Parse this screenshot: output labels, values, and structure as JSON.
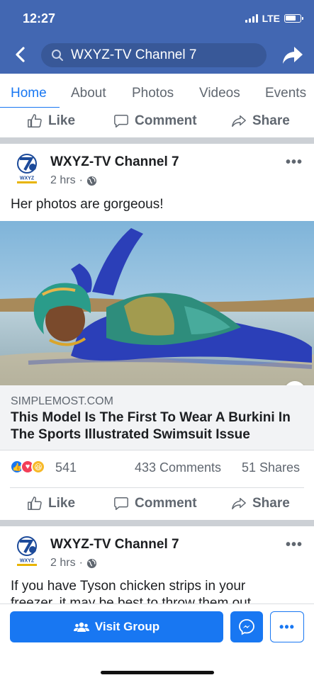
{
  "status_bar": {
    "time": "12:27",
    "network": "LTE"
  },
  "header": {
    "search_text": "WXYZ-TV Channel 7"
  },
  "tabs": [
    {
      "label": "Home",
      "active": true
    },
    {
      "label": "About"
    },
    {
      "label": "Photos"
    },
    {
      "label": "Videos"
    },
    {
      "label": "Events"
    }
  ],
  "actions": {
    "like": "Like",
    "comment": "Comment",
    "share": "Share"
  },
  "posts": [
    {
      "page_name": "WXYZ-TV Channel 7",
      "time": "2 hrs",
      "text": "Her photos are gorgeous!",
      "link": {
        "domain": "SIMPLEMOST.COM",
        "title": "This Model Is The First To Wear A Burkini In The Sports Illustrated Swimsuit Issue"
      },
      "reactions_count": "541",
      "comments": "433 Comments",
      "shares": "51 Shares",
      "logo_text": "WXYZ"
    },
    {
      "page_name": "WXYZ-TV Channel 7",
      "time": "2 hrs",
      "text": "If you have Tyson chicken strips in your",
      "text_cut": "freezer, it may be best to throw them out",
      "logo_text": "WXYZ"
    }
  ],
  "bottom": {
    "visit_group": "Visit Group"
  },
  "colors": {
    "brand": "#4267b2",
    "accent": "#1877f2",
    "muted": "#606770"
  },
  "icons": [
    "back-arrow-icon",
    "search-icon",
    "share-arrow-icon",
    "thumbs-up-icon",
    "comment-bubble-icon",
    "share-icon",
    "globe-icon",
    "info-icon",
    "group-icon",
    "messenger-icon",
    "more-icon"
  ]
}
